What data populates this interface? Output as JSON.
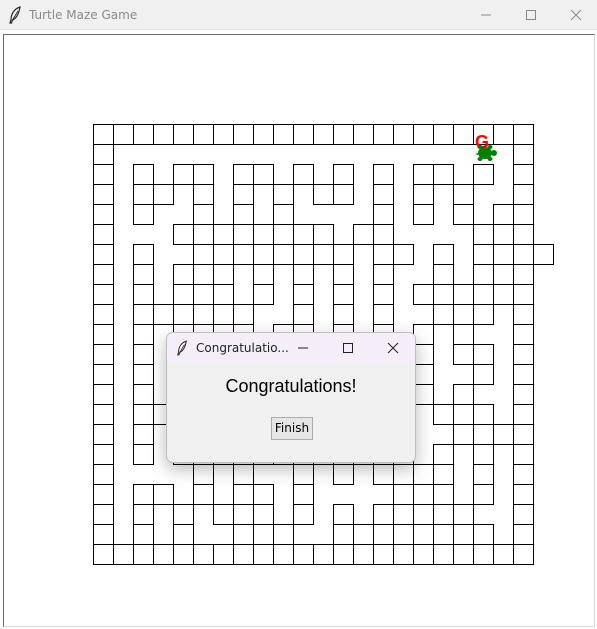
{
  "window": {
    "title": "Turtle Maze Game",
    "icon": "feather-icon"
  },
  "maze": {
    "goal_label": "G",
    "goal_color": "#ff0000",
    "turtle_color": "#008000",
    "rows": [
      "0000000000000000000000",
      "0xxxxxxxxxxxxxxxxxxxx0",
      "0x0x00x00x0x0x0x00x0x0",
      "0x00x0x0x0x00x0x0x0xx0",
      "0x0xx0x0x0xxxx0x0x0x00",
      "0xxx0x0x0x00x00xxxx0x0",
      "0x0xx0x0x0x00x00x0x00x0",
      "0x0x000x0x0x0x0xx0x0x0",
      "0x0x0x0x0x0x0x0x0x0x00",
      "0x00x0x0xx0x0x0xx0x0x0",
      "0x0x0x00x00x0x0x0x0xx0",
      "0x0x0xxx0x0x0x0x0x00x0",
      "0x0x0x0x0x0x0x0x0xx0x0",
      "0x0x0x0x0x0x0x0x0x0xx0",
      "0x00x0x0x0x0x0x0x0x0x0",
      "0x0xx0x0x0x0x0x0xx0x00",
      "0x0x0x0x00x0x0x0x0x0x0",
      "0xxxx0x0xx0x0x0x00x0x0",
      "0x00x0x00x0xxxx0x0x0x0",
      "0x0x0x0x0x0x0x0x0x0xx0",
      "0x0x0xx0x0xx00x0x0x0x0",
      "0000000000000000000000"
    ]
  },
  "dialog": {
    "title": "Congratulatio...",
    "message": "Congratulations!",
    "button_label": "Finish",
    "icon": "feather-icon"
  }
}
